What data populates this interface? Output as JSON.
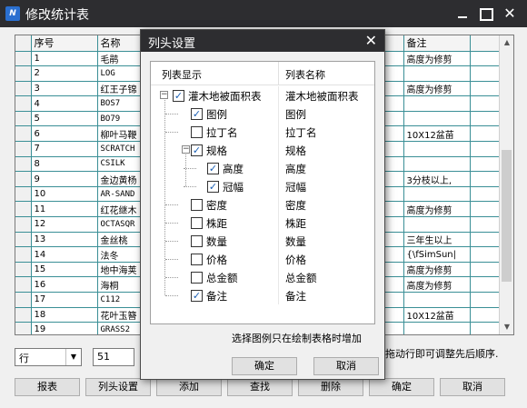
{
  "window": {
    "title": "修改统计表",
    "icon_letter": "N"
  },
  "table": {
    "headers": [
      "序号",
      "名称",
      "位",
      "备注"
    ],
    "rows": [
      {
        "no": "1",
        "name": "毛鹃",
        "note": "高度为修剪"
      },
      {
        "no": "2",
        "name": "LOG",
        "note": ""
      },
      {
        "no": "3",
        "name": "红王子锦",
        "note": "高度为修剪"
      },
      {
        "no": "4",
        "name": "BOS7",
        "note": ""
      },
      {
        "no": "5",
        "name": "BO79",
        "note": ""
      },
      {
        "no": "6",
        "name": "柳叶马鞭",
        "note": "10X12盆苗"
      },
      {
        "no": "7",
        "name": "SCRATCH",
        "note": ""
      },
      {
        "no": "8",
        "name": "CSILK",
        "note": ""
      },
      {
        "no": "9",
        "name": "金边黄杨",
        "note": "3分枝以上,"
      },
      {
        "no": "10",
        "name": "AR-SAND",
        "note": ""
      },
      {
        "no": "11",
        "name": "红花继木",
        "note": "高度为修剪"
      },
      {
        "no": "12",
        "name": "OCTASQR",
        "note": ""
      },
      {
        "no": "13",
        "name": "金丝桃",
        "note": "三年生以上"
      },
      {
        "no": "14",
        "name": "法冬",
        "note": "{\\fSimSun|"
      },
      {
        "no": "15",
        "name": "地中海荚",
        "note": "高度为修剪"
      },
      {
        "no": "16",
        "name": "海桐",
        "note": "高度为修剪"
      },
      {
        "no": "17",
        "name": "C112",
        "note": ""
      },
      {
        "no": "18",
        "name": "花叶玉簪",
        "note": "10X12盆苗"
      },
      {
        "no": "19",
        "name": "GRASS2",
        "note": ""
      }
    ]
  },
  "controls": {
    "combo_value": "行",
    "number_value": "51",
    "hint_right": "拖动行即可调整先后顺序."
  },
  "buttons": {
    "report": "报表",
    "column_settings": "列头设置",
    "add": "添加",
    "find": "查找",
    "delete": "删除",
    "ok": "确定",
    "cancel": "取消"
  },
  "dialog": {
    "title": "列头设置",
    "col_display": "列表显示",
    "col_name": "列表名称",
    "items": [
      {
        "label": "灌木地被面积表",
        "name": "灌木地被面积表",
        "checked": true,
        "level": 0,
        "toggle": "−"
      },
      {
        "label": "图例",
        "name": "图例",
        "checked": true,
        "level": 1
      },
      {
        "label": "拉丁名",
        "name": "拉丁名",
        "checked": false,
        "level": 1
      },
      {
        "label": "规格",
        "name": "规格",
        "checked": true,
        "level": 1,
        "toggle": "−"
      },
      {
        "label": "高度",
        "name": "高度",
        "checked": true,
        "level": 2
      },
      {
        "label": "冠幅",
        "name": "冠幅",
        "checked": true,
        "level": 2
      },
      {
        "label": "密度",
        "name": "密度",
        "checked": false,
        "level": 1
      },
      {
        "label": "株距",
        "name": "株距",
        "checked": false,
        "level": 1
      },
      {
        "label": "数量",
        "name": "数量",
        "checked": false,
        "level": 1
      },
      {
        "label": "价格",
        "name": "价格",
        "checked": false,
        "level": 1
      },
      {
        "label": "总金额",
        "name": "总金额",
        "checked": false,
        "level": 1
      },
      {
        "label": "备注",
        "name": "备注",
        "checked": true,
        "level": 1
      }
    ],
    "hint": "选择图例只在绘制表格时增加",
    "ok": "确定",
    "cancel": "取消"
  },
  "colors": {
    "titlebar": "#2d2d30",
    "grid": "#3a8f96",
    "check": "#1a5fb4"
  }
}
